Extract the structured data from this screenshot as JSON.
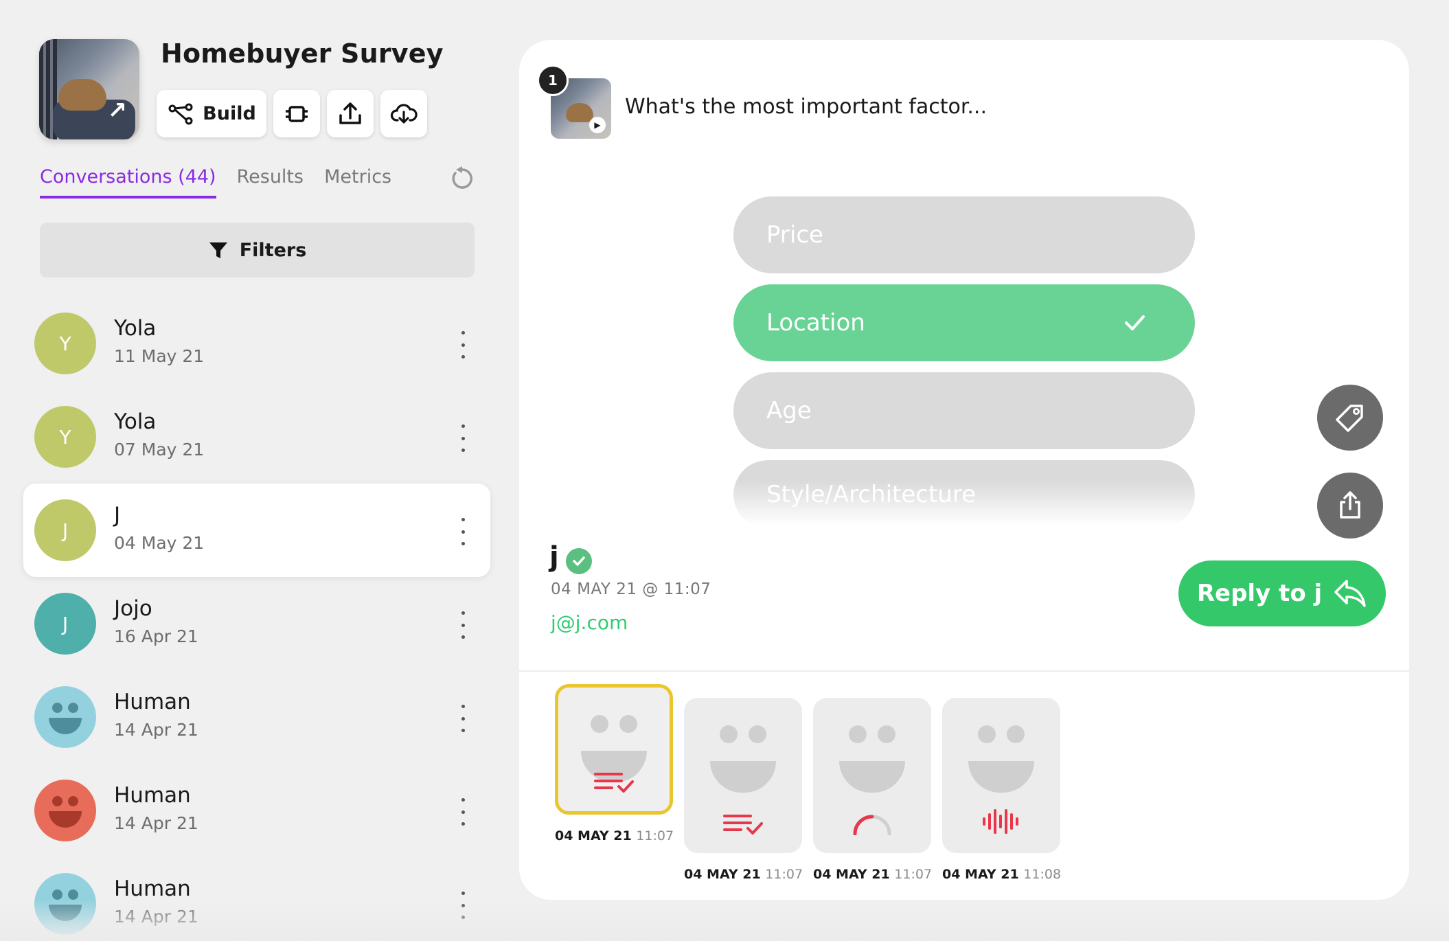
{
  "survey": {
    "title": "Homebuyer Survey",
    "build_label": "Build"
  },
  "tabs": [
    {
      "label": "Conversations (44)",
      "active": true
    },
    {
      "label": "Results",
      "active": false
    },
    {
      "label": "Metrics",
      "active": false
    }
  ],
  "filters_label": "Filters",
  "conversations": [
    {
      "name": "Yola",
      "date": "11 May 21",
      "avatar": "letter",
      "initial": "Y",
      "color": "#bfc96a"
    },
    {
      "name": "Yola",
      "date": "07 May 21",
      "avatar": "letter",
      "initial": "Y",
      "color": "#bfc96a"
    },
    {
      "name": "J",
      "date": "04 May 21",
      "avatar": "letter",
      "initial": "J",
      "color": "#bfc96a",
      "selected": true
    },
    {
      "name": "Jojo",
      "date": "16 Apr 21",
      "avatar": "letter",
      "initial": "J",
      "color": "#4fb0ab"
    },
    {
      "name": "Human",
      "date": "14 Apr 21",
      "avatar": "face",
      "color": "#94d1df"
    },
    {
      "name": "Human",
      "date": "14 Apr 21",
      "avatar": "face",
      "color": "#e86c5a"
    },
    {
      "name": "Human",
      "date": "14 Apr 21",
      "avatar": "face",
      "color": "#94d1df"
    }
  ],
  "question": {
    "number": "1",
    "text": "What's the most important factor..."
  },
  "options": [
    {
      "label": "Price",
      "chosen": false
    },
    {
      "label": "Location",
      "chosen": true
    },
    {
      "label": "Age",
      "chosen": false
    },
    {
      "label": "Style/Architecture",
      "chosen": false
    }
  ],
  "respondent": {
    "name": "j",
    "timestamp": "04 MAY 21 @ 11:07",
    "email": "j@j.com"
  },
  "reply_label": "Reply to j",
  "steps": [
    {
      "date": "04 MAY 21",
      "time": "11:07",
      "icon": "list-check",
      "current": true
    },
    {
      "date": "04 MAY 21",
      "time": "11:07",
      "icon": "list-check",
      "current": false
    },
    {
      "date": "04 MAY 21",
      "time": "11:07",
      "icon": "gauge",
      "current": false
    },
    {
      "date": "04 MAY 21",
      "time": "11:08",
      "icon": "audio-wave",
      "current": false
    }
  ],
  "colors": {
    "accent_purple": "#8a2be2",
    "selected_option": "#69d395",
    "reply_green": "#34c86b",
    "current_step": "#e9c62e",
    "step_icon_red": "#e8374a"
  }
}
